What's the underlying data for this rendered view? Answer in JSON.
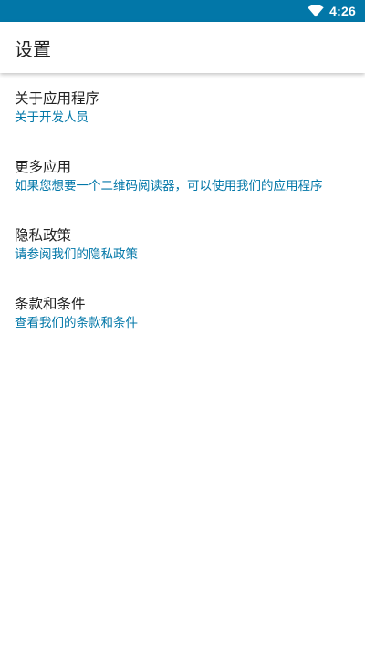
{
  "status_bar": {
    "time": "4:26",
    "icons": [
      "wifi-icon"
    ],
    "background": "#0277a8"
  },
  "app_bar": {
    "title": "设置"
  },
  "settings": {
    "items": [
      {
        "title": "关于应用程序",
        "summary": "关于开发人员"
      },
      {
        "title": "更多应用",
        "summary": "如果您想要一个二维码阅读器，可以使用我们的应用程序"
      },
      {
        "title": "隐私政策",
        "summary": "请参阅我们的隐私政策"
      },
      {
        "title": "条款和条件",
        "summary": "查看我们的条款和条件"
      }
    ]
  },
  "colors": {
    "accent": "#0277a8",
    "title_text": "#212121",
    "background": "#ffffff"
  }
}
